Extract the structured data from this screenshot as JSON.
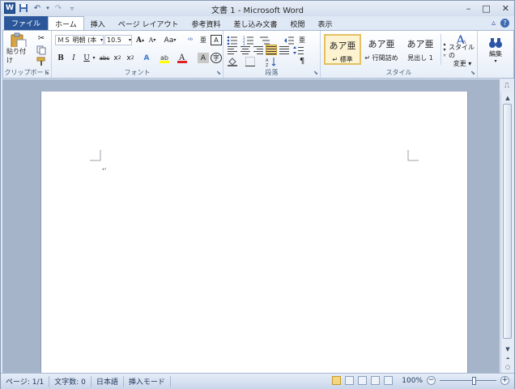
{
  "window": {
    "title": "文書 1 - Microsoft Word",
    "app_icon": "W"
  },
  "qat": {
    "save_icon": "save-icon",
    "undo_icon": "undo-icon",
    "redo_icon": "redo-icon"
  },
  "tabs": [
    {
      "label": "ファイル",
      "kind": "file"
    },
    {
      "label": "ホーム",
      "kind": "active"
    },
    {
      "label": "挿入"
    },
    {
      "label": "ページ レイアウト"
    },
    {
      "label": "参考資料"
    },
    {
      "label": "差し込み文書"
    },
    {
      "label": "校閲"
    },
    {
      "label": "表示"
    }
  ],
  "ribbon": {
    "clipboard": {
      "paste_label": "貼り付け",
      "group_label": "クリップボード"
    },
    "font": {
      "font_name": "ＭＳ 明朝 (本",
      "font_size": "10.5",
      "aa_label": "Aa",
      "group_label": "フォント"
    },
    "paragraph": {
      "group_label": "段落"
    },
    "styles": {
      "items": [
        {
          "preview": "あア亜",
          "name": "↵ 標準"
        },
        {
          "preview": "あア亜",
          "name": "↵ 行間詰め"
        },
        {
          "preview": "あア亜",
          "name": "見出し 1"
        }
      ],
      "change_label_1": "スタイルの",
      "change_label_2": "変更 ▾",
      "group_label": "スタイル"
    },
    "editing": {
      "label": "編集"
    }
  },
  "status": {
    "page": "ページ: 1/1",
    "word_count": "文字数: 0",
    "language": "日本語",
    "mode": "挿入モード",
    "zoom": "100%"
  },
  "colors": {
    "file_tab": "#2b579a",
    "ribbon_bg": "#dfe8f5",
    "doc_bg": "#a5b4c8"
  }
}
